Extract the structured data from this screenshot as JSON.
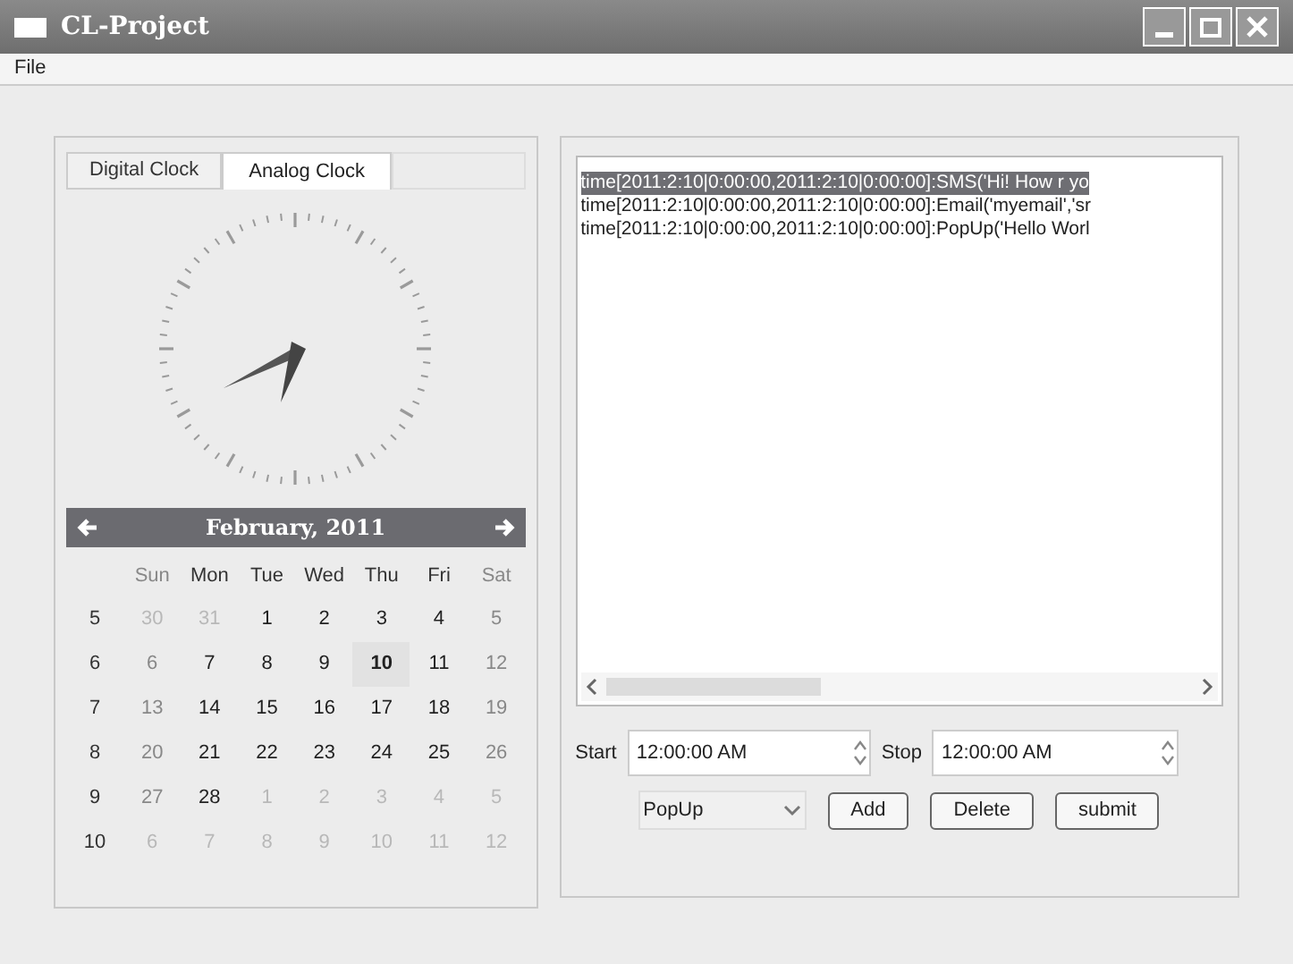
{
  "window": {
    "title": "CL-Project"
  },
  "menu": [
    "File"
  ],
  "tabs": [
    {
      "label": "Digital Clock",
      "selected": false
    },
    {
      "label": "Analog Clock",
      "selected": true
    }
  ],
  "calendar": {
    "month": "February, 2011",
    "weekdays": [
      "Sun",
      "Mon",
      "Tue",
      "Wed",
      "Thu",
      "Fri",
      "Sat"
    ],
    "weeks": [
      {
        "number": "5",
        "days": [
          {
            "text": "30",
            "kind": "other",
            "selected": false
          },
          {
            "text": "31",
            "kind": "other",
            "selected": false
          },
          {
            "text": "1",
            "kind": "current",
            "selected": false
          },
          {
            "text": "2",
            "kind": "current",
            "selected": false
          },
          {
            "text": "3",
            "kind": "current",
            "selected": false
          },
          {
            "text": "4",
            "kind": "current",
            "selected": false
          },
          {
            "text": "5",
            "kind": "current",
            "selected": false
          }
        ]
      },
      {
        "number": "6",
        "days": [
          {
            "text": "6",
            "kind": "current",
            "selected": false
          },
          {
            "text": "7",
            "kind": "current",
            "selected": false
          },
          {
            "text": "8",
            "kind": "current",
            "selected": false
          },
          {
            "text": "9",
            "kind": "current",
            "selected": false
          },
          {
            "text": "10",
            "kind": "current",
            "selected": true
          },
          {
            "text": "11",
            "kind": "current",
            "selected": false
          },
          {
            "text": "12",
            "kind": "current",
            "selected": false
          }
        ]
      },
      {
        "number": "7",
        "days": [
          {
            "text": "13",
            "kind": "current",
            "selected": false
          },
          {
            "text": "14",
            "kind": "current",
            "selected": false
          },
          {
            "text": "15",
            "kind": "current",
            "selected": false
          },
          {
            "text": "16",
            "kind": "current",
            "selected": false
          },
          {
            "text": "17",
            "kind": "current",
            "selected": false
          },
          {
            "text": "18",
            "kind": "current",
            "selected": false
          },
          {
            "text": "19",
            "kind": "current",
            "selected": false
          }
        ]
      },
      {
        "number": "8",
        "days": [
          {
            "text": "20",
            "kind": "current",
            "selected": false
          },
          {
            "text": "21",
            "kind": "current",
            "selected": false
          },
          {
            "text": "22",
            "kind": "current",
            "selected": false
          },
          {
            "text": "23",
            "kind": "current",
            "selected": false
          },
          {
            "text": "24",
            "kind": "current",
            "selected": false
          },
          {
            "text": "25",
            "kind": "current",
            "selected": false
          },
          {
            "text": "26",
            "kind": "current",
            "selected": false
          }
        ]
      },
      {
        "number": "9",
        "days": [
          {
            "text": "27",
            "kind": "current",
            "selected": false
          },
          {
            "text": "28",
            "kind": "current",
            "selected": false
          },
          {
            "text": "1",
            "kind": "other",
            "selected": false
          },
          {
            "text": "2",
            "kind": "other",
            "selected": false
          },
          {
            "text": "3",
            "kind": "other",
            "selected": false
          },
          {
            "text": "4",
            "kind": "other",
            "selected": false
          },
          {
            "text": "5",
            "kind": "other",
            "selected": false
          }
        ]
      },
      {
        "number": "10",
        "days": [
          {
            "text": "6",
            "kind": "other",
            "selected": false
          },
          {
            "text": "7",
            "kind": "other",
            "selected": false
          },
          {
            "text": "8",
            "kind": "other",
            "selected": false
          },
          {
            "text": "9",
            "kind": "other",
            "selected": false
          },
          {
            "text": "10",
            "kind": "other",
            "selected": false
          },
          {
            "text": "11",
            "kind": "other",
            "selected": false
          },
          {
            "text": "12",
            "kind": "other",
            "selected": false
          }
        ]
      }
    ]
  },
  "list": [
    {
      "text": "time[2011:2:10|0:00:00,2011:2:10|0:00:00]:SMS('Hi! How r yo",
      "selected": true
    },
    {
      "text": "time[2011:2:10|0:00:00,2011:2:10|0:00:00]:Email('myemail','sr",
      "selected": false
    },
    {
      "text": "time[2011:2:10|0:00:00,2011:2:10|0:00:00]:PopUp('Hello Worl",
      "selected": false
    }
  ],
  "start": {
    "label": "Start",
    "value": "12:00:00 AM"
  },
  "stop": {
    "label": "Stop",
    "value": "12:00:00 AM"
  },
  "type_select": {
    "value": "PopUp"
  },
  "buttons": [
    "Add",
    "Delete",
    "submit"
  ]
}
